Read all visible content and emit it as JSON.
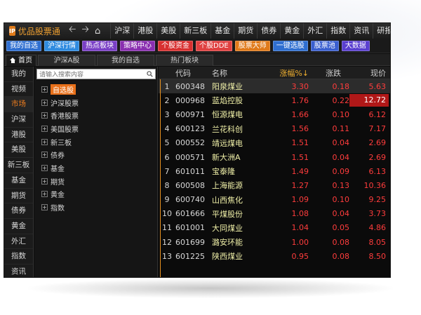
{
  "app": {
    "logo_text": "IP",
    "name": "优品股票通",
    "menu": [
      "沪深",
      "港股",
      "美股",
      "新三板",
      "基金",
      "期货",
      "债券",
      "黄金",
      "外汇",
      "指数",
      "资讯",
      "研报"
    ]
  },
  "toolbar": {
    "buttons": [
      {
        "label": "我的自选",
        "color": "#2f6fd1"
      },
      {
        "label": "沪深行情",
        "color": "#2f8be0"
      },
      {
        "label": "热点板块",
        "color": "#7a3fc6"
      },
      {
        "label": "策略中心",
        "color": "#8a2fb0"
      },
      {
        "label": "个股资金",
        "color": "#d83030"
      },
      {
        "label": "个股DDE",
        "color": "#e04040"
      },
      {
        "label": "股票大师",
        "color": "#e07a1a"
      },
      {
        "label": "一键选股",
        "color": "#2f6fd1"
      },
      {
        "label": "股票池",
        "color": "#3a5fd0"
      },
      {
        "label": "大数据",
        "color": "#5a3fd0"
      }
    ]
  },
  "tabs": [
    "首页",
    "沪深A股",
    "我的自选",
    "热门板块"
  ],
  "sidebar": {
    "items": [
      "我的",
      "视频",
      "市场",
      "沪深",
      "港股",
      "美股",
      "新三板",
      "基金",
      "期货",
      "债券",
      "黄金",
      "外汇",
      "指数",
      "资讯"
    ],
    "active_index": 2
  },
  "tree": {
    "search_placeholder": "请输入搜索内容",
    "items": [
      "自选股",
      "沪深股票",
      "香港股票",
      "美国股票",
      "新三板",
      "债券",
      "基金",
      "期货",
      "黄金",
      "指数"
    ],
    "active_index": 0
  },
  "table": {
    "headers": {
      "code": "代码",
      "name": "名称",
      "pct": "涨幅%↓",
      "chg": "涨跌",
      "price": "现价"
    },
    "rows": [
      {
        "idx": "1",
        "code": "600348",
        "name": "阳泉煤业",
        "pct": "3.30",
        "chg": "0.18",
        "price": "5.63"
      },
      {
        "idx": "2",
        "code": "000968",
        "name": "蓝焰控股",
        "pct": "1.76",
        "chg": "0.22",
        "price": "12.72"
      },
      {
        "idx": "3",
        "code": "600971",
        "name": "恒源煤电",
        "pct": "1.66",
        "chg": "0.10",
        "price": "6.12"
      },
      {
        "idx": "4",
        "code": "600123",
        "name": "兰花科创",
        "pct": "1.56",
        "chg": "0.11",
        "price": "7.17"
      },
      {
        "idx": "5",
        "code": "000552",
        "name": "靖远煤电",
        "pct": "1.51",
        "chg": "0.04",
        "price": "2.69"
      },
      {
        "idx": "6",
        "code": "000571",
        "name": "新大洲A",
        "pct": "1.51",
        "chg": "0.04",
        "price": "2.69"
      },
      {
        "idx": "7",
        "code": "601011",
        "name": "宝泰隆",
        "pct": "1.49",
        "chg": "0.09",
        "price": "6.13"
      },
      {
        "idx": "8",
        "code": "600508",
        "name": "上海能源",
        "pct": "1.27",
        "chg": "0.13",
        "price": "10.36"
      },
      {
        "idx": "9",
        "code": "600740",
        "name": "山西焦化",
        "pct": "1.09",
        "chg": "0.10",
        "price": "9.25"
      },
      {
        "idx": "10",
        "code": "601666",
        "name": "平煤股份",
        "pct": "1.08",
        "chg": "0.04",
        "price": "3.73"
      },
      {
        "idx": "11",
        "code": "601001",
        "name": "大同煤业",
        "pct": "1.04",
        "chg": "0.05",
        "price": "4.86"
      },
      {
        "idx": "12",
        "code": "601699",
        "name": "潞安环能",
        "pct": "1.00",
        "chg": "0.08",
        "price": "8.05"
      },
      {
        "idx": "13",
        "code": "601225",
        "name": "陕西煤业",
        "pct": "0.95",
        "chg": "0.08",
        "price": "8.50"
      }
    ],
    "selected_index": 0,
    "highlight_price_index": 1,
    "up_color": "#ff3c3c"
  }
}
